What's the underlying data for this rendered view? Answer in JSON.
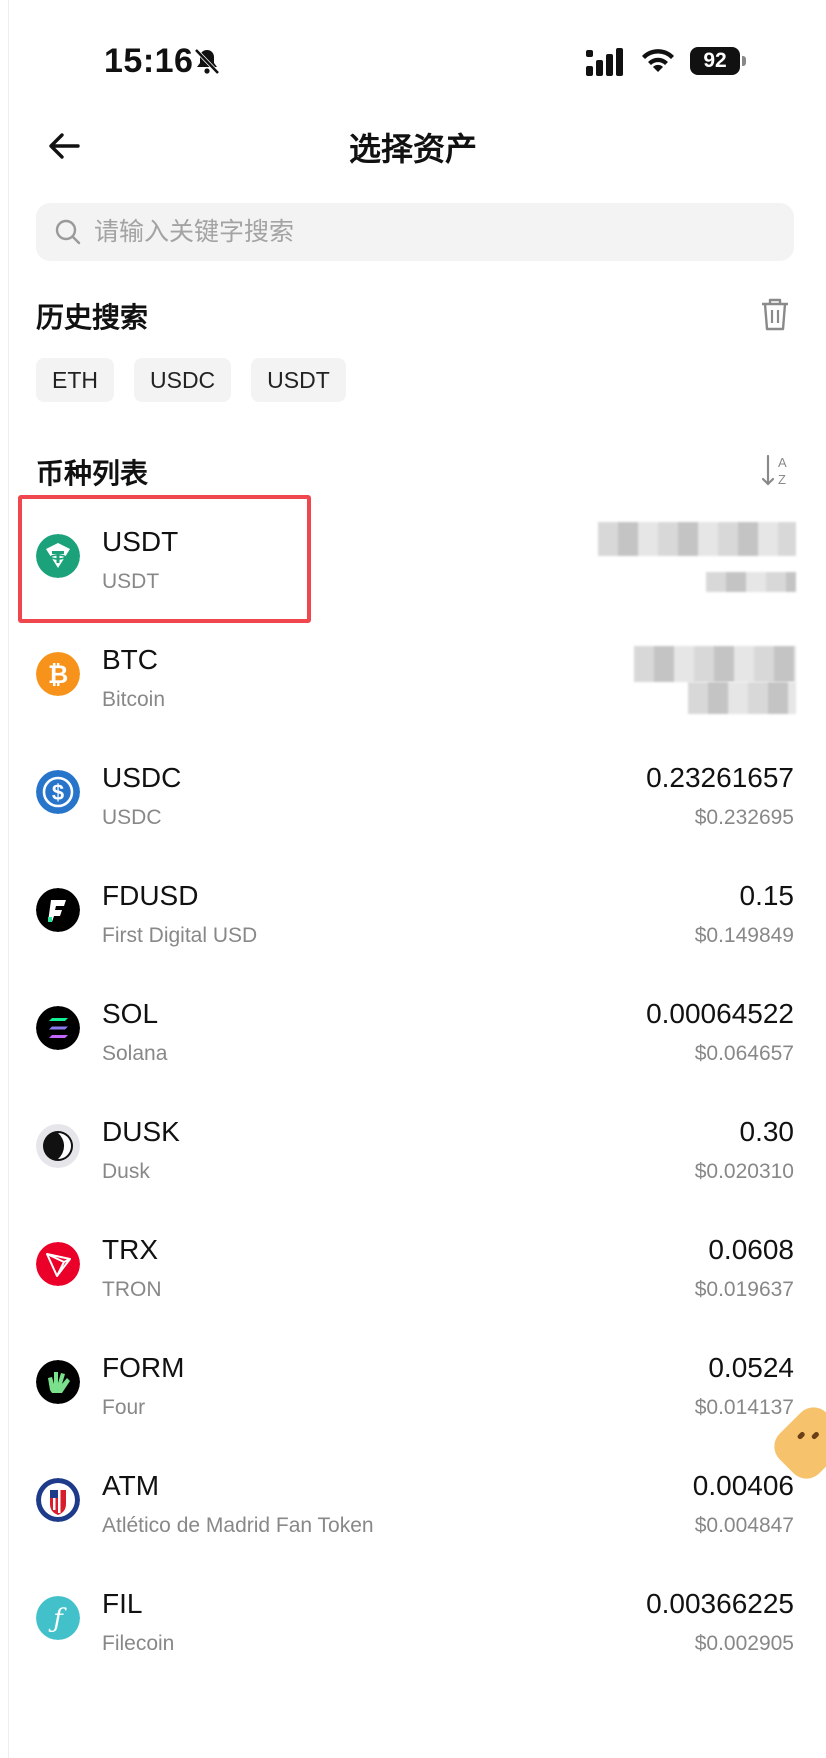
{
  "status_bar": {
    "time": "15:16",
    "battery": "92"
  },
  "header": {
    "title": "选择资产"
  },
  "search": {
    "placeholder": "请输入关键字搜索"
  },
  "history": {
    "title": "历史搜索",
    "chips": [
      "ETH",
      "USDC",
      "USDT"
    ]
  },
  "coin_list": {
    "title": "币种列表",
    "items": [
      {
        "symbol": "USDT",
        "name": "USDT",
        "amount": "",
        "value": "",
        "icon": "tether-icon",
        "color": "#26a17b"
      },
      {
        "symbol": "BTC",
        "name": "Bitcoin",
        "amount": "",
        "value": "",
        "icon": "bitcoin-icon",
        "color": "#f7931a"
      },
      {
        "symbol": "USDC",
        "name": "USDC",
        "amount": "0.23261657",
        "value": "$0.232695",
        "icon": "usdc-icon",
        "color": "#2775ca"
      },
      {
        "symbol": "FDUSD",
        "name": "First Digital USD",
        "amount": "0.15",
        "value": "$0.149849",
        "icon": "fdusd-icon",
        "color": "#000000"
      },
      {
        "symbol": "SOL",
        "name": "Solana",
        "amount": "0.00064522",
        "value": "$0.064657",
        "icon": "solana-icon",
        "color": "#000000"
      },
      {
        "symbol": "DUSK",
        "name": "Dusk",
        "amount": "0.30",
        "value": "$0.020310",
        "icon": "dusk-icon",
        "color": "#e5e5ea"
      },
      {
        "symbol": "TRX",
        "name": "TRON",
        "amount": "0.0608",
        "value": "$0.019637",
        "icon": "tron-icon",
        "color": "#eb0029"
      },
      {
        "symbol": "FORM",
        "name": "Four",
        "amount": "0.0524",
        "value": "$0.014137",
        "icon": "four-icon",
        "color": "#000000"
      },
      {
        "symbol": "ATM",
        "name": "Atlético de Madrid Fan Token",
        "amount": "0.00406",
        "value": "$0.004847",
        "icon": "atletico-icon",
        "color": "#1e3a8a"
      },
      {
        "symbol": "FIL",
        "name": "Filecoin",
        "amount": "0.00366225",
        "value": "$0.002905",
        "icon": "filecoin-icon",
        "color": "#42c1ca"
      }
    ]
  },
  "colors": {
    "highlight": "#f0474f",
    "chip_bg": "#f3f3f3",
    "muted_text": "#888888"
  }
}
